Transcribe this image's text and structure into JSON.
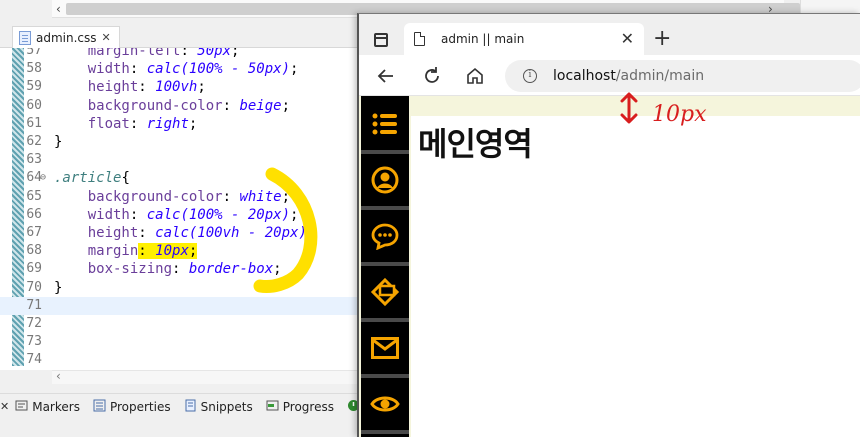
{
  "editor": {
    "file_tab": "admin.css",
    "lines": [
      {
        "n": "57",
        "parts": [
          [
            "p",
            "    "
          ],
          [
            "kw",
            "margin-left"
          ],
          [
            "p",
            ": "
          ],
          [
            "val",
            "50px"
          ],
          [
            "p",
            ";"
          ]
        ]
      },
      {
        "n": "58",
        "parts": [
          [
            "p",
            "    "
          ],
          [
            "kw",
            "width"
          ],
          [
            "p",
            ": "
          ],
          [
            "val",
            "calc(100% - 50px)"
          ],
          [
            "p",
            ";"
          ]
        ]
      },
      {
        "n": "59",
        "parts": [
          [
            "p",
            "    "
          ],
          [
            "kw",
            "height"
          ],
          [
            "p",
            ": "
          ],
          [
            "val",
            "100vh"
          ],
          [
            "p",
            ";"
          ]
        ]
      },
      {
        "n": "60",
        "parts": [
          [
            "p",
            "    "
          ],
          [
            "kw",
            "background-color"
          ],
          [
            "p",
            ": "
          ],
          [
            "val",
            "beige"
          ],
          [
            "p",
            ";"
          ]
        ]
      },
      {
        "n": "61",
        "parts": [
          [
            "p",
            "    "
          ],
          [
            "kw",
            "float"
          ],
          [
            "p",
            ": "
          ],
          [
            "val",
            "right"
          ],
          [
            "p",
            ";"
          ]
        ]
      },
      {
        "n": "62",
        "parts": [
          [
            "p",
            "}"
          ]
        ]
      },
      {
        "n": "63",
        "parts": []
      },
      {
        "n": "64",
        "parts": [
          [
            "sel",
            ".article"
          ],
          [
            "p",
            "{"
          ]
        ]
      },
      {
        "n": "65",
        "parts": [
          [
            "p",
            "    "
          ],
          [
            "kw",
            "background-color"
          ],
          [
            "p",
            ": "
          ],
          [
            "val",
            "white"
          ],
          [
            "p",
            ";"
          ]
        ]
      },
      {
        "n": "66",
        "parts": [
          [
            "p",
            "    "
          ],
          [
            "kw",
            "width"
          ],
          [
            "p",
            ": "
          ],
          [
            "val",
            "calc(100% - 20px)"
          ],
          [
            "p",
            ";"
          ]
        ]
      },
      {
        "n": "67",
        "parts": [
          [
            "p",
            "    "
          ],
          [
            "kw",
            "height"
          ],
          [
            "p",
            ": "
          ],
          [
            "val",
            "calc(100vh - 20px)"
          ],
          [
            "p",
            ";"
          ]
        ]
      },
      {
        "n": "68",
        "parts": [
          [
            "p",
            "    "
          ],
          [
            "kw",
            "margin"
          ],
          [
            "hlp",
            ": "
          ],
          [
            "hlv",
            "10px"
          ],
          [
            "hlp",
            ";"
          ]
        ]
      },
      {
        "n": "69",
        "parts": [
          [
            "p",
            "    "
          ],
          [
            "kw",
            "box-sizing"
          ],
          [
            "p",
            ": "
          ],
          [
            "val",
            "border-box"
          ],
          [
            "p",
            ";"
          ]
        ]
      },
      {
        "n": "70",
        "parts": [
          [
            "p",
            "}"
          ]
        ]
      },
      {
        "n": "71",
        "parts": []
      },
      {
        "n": "72",
        "parts": []
      },
      {
        "n": "73",
        "parts": []
      },
      {
        "n": "74",
        "parts": []
      }
    ]
  },
  "bottom_tabs": [
    {
      "label": "Markers",
      "icon": "markers-icon"
    },
    {
      "label": "Properties",
      "icon": "properties-icon"
    },
    {
      "label": "Snippets",
      "icon": "snippets-icon"
    },
    {
      "label": "Progress",
      "icon": "progress-icon"
    },
    {
      "label": "Boo",
      "icon": "boot-dashboard-icon"
    }
  ],
  "browser": {
    "tab_title": "admin || main",
    "url_host": "localhost",
    "url_path": "/admin/main",
    "main_heading": "메인영역",
    "sidebar_icons": [
      "list-icon",
      "user-circle-icon",
      "chat-icon",
      "sign-icon",
      "mail-icon",
      "eye-icon"
    ],
    "accent_color": "#f5a400"
  },
  "annotation": {
    "text": "10px",
    "color": "#d81e1e"
  }
}
